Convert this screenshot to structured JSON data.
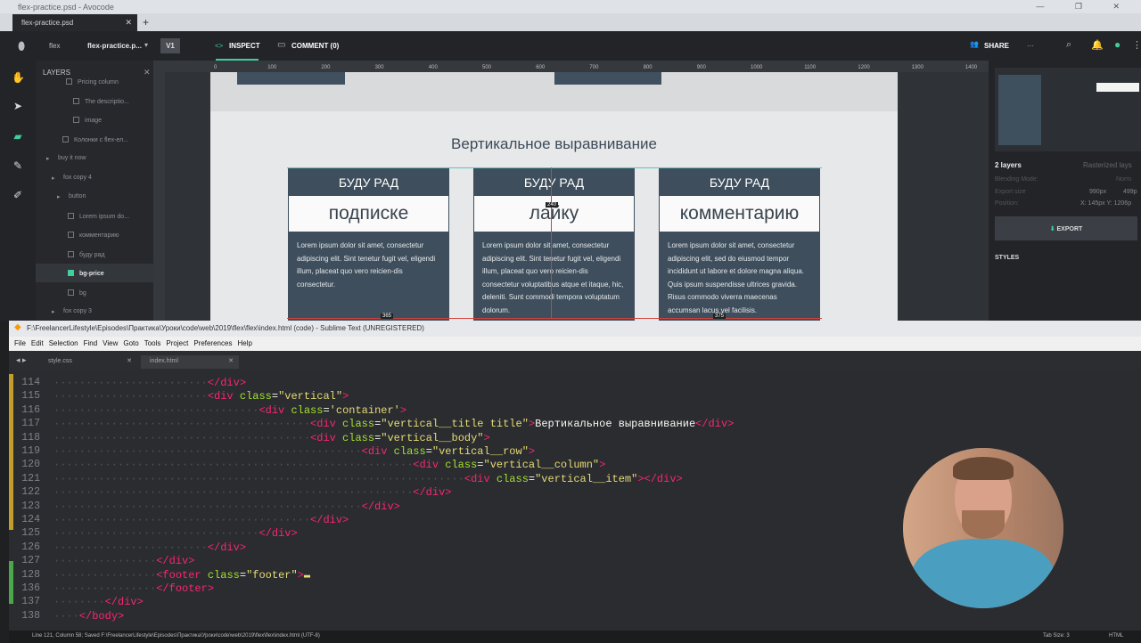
{
  "browser": {
    "title": "flex-practice.psd - Avocode",
    "tab": "flex-practice.psd",
    "new_tab": "+",
    "win_controls": "—  ❐  ✕"
  },
  "avocode": {
    "breadcrumb_project": "flex",
    "breadcrumb_file": "flex-practice.p...",
    "version": "V1",
    "inspect": "INSPECT",
    "comment": "COMMENT (0)",
    "share": "SHARE",
    "more": "···"
  },
  "layers": {
    "title": "LAYERS",
    "items": [
      {
        "label": "Pricing column",
        "kind": "text"
      },
      {
        "label": "The descriptio...",
        "kind": "text"
      },
      {
        "label": "image",
        "kind": "image"
      },
      {
        "label": "Колонки с flex-ел...",
        "kind": "text"
      },
      {
        "label": "buy it now",
        "kind": "folder"
      },
      {
        "label": "fox copy 4",
        "kind": "folder"
      },
      {
        "label": "button",
        "kind": "folder"
      },
      {
        "label": "Lorem ipsum do...",
        "kind": "text"
      },
      {
        "label": "комментарию",
        "kind": "text"
      },
      {
        "label": "буду рад",
        "kind": "text"
      },
      {
        "label": "bg-price",
        "kind": "shape",
        "selected": true
      },
      {
        "label": "bg",
        "kind": "shape"
      },
      {
        "label": "fox copy 3",
        "kind": "folder"
      }
    ]
  },
  "ruler": {
    "marks": [
      "0",
      "100",
      "200",
      "300",
      "400",
      "500",
      "600",
      "700",
      "800",
      "900",
      "1000",
      "1100",
      "1200",
      "1300",
      "1400"
    ]
  },
  "design": {
    "title": "Вертикальное выравнивание",
    "cards": [
      {
        "head": "БУДУ РАД",
        "word": "подписке",
        "text": "Lorem ipsum dolor sit amet, consectetur adipiscing elit. Sint tenetur fugit vel, eligendi illum, placeat quo vero reicien-dis consectetur."
      },
      {
        "head": "БУДУ РАД",
        "word": "лайку",
        "text": "Lorem ipsum dolor sit amet, consectetur adipiscing elit. Sint tenetur fugit vel, eligendi illum, placeat quo vero reicien-dis consectetur voluptatibus atque et itaque, hic, deleniti. Sunt commodi tempora voluptatum dolorum."
      },
      {
        "head": "БУДУ РАД",
        "word": "комментарию",
        "text": "Lorem ipsum dolor sit amet, consectetur adipiscing elit, sed do eiusmod tempor incididunt ut labore et dolore magna aliqua. Quis ipsum suspendisse ultrices gravida. Risus commodo viverra maecenas accumsan lacus vel facilisis."
      }
    ],
    "measure_1": "365",
    "measure_2": "375",
    "measure_3": "240"
  },
  "inspector": {
    "layers_count": "2 layers",
    "rasterized": "Rasterized lays",
    "blending_label": "Blending Mode:",
    "blending_value": "Norm",
    "export_size_label": "Export size",
    "w": "990px",
    "h": "499p",
    "position_label": "Position:",
    "position": "X: 145px  Y: 1206p",
    "export_btn": "EXPORT",
    "styles": "STYLES"
  },
  "sublime": {
    "title": "F:\\FreelancerLifestyle\\Episodes\\Практика\\Урoки\\code\\web\\2019\\flex\\flex\\index.html (code) - Sublime Text (UNREGISTERED)",
    "menu": [
      "File",
      "Edit",
      "Selection",
      "Find",
      "View",
      "Goto",
      "Tools",
      "Project",
      "Preferences",
      "Help"
    ],
    "tabs": [
      "style.css",
      "index.html"
    ],
    "lines": [
      {
        "n": "114",
        "indent": 12,
        "parts": [
          [
            "tg",
            "</div>"
          ]
        ]
      },
      {
        "n": "115",
        "indent": 12,
        "parts": [
          [
            "tg",
            "<div"
          ],
          [
            "at",
            " class"
          ],
          [
            "tx",
            "="
          ],
          [
            "st",
            "\"vertical\""
          ],
          [
            "tg",
            ">"
          ]
        ]
      },
      {
        "n": "116",
        "indent": 16,
        "parts": [
          [
            "tg",
            "<div"
          ],
          [
            "at",
            " class"
          ],
          [
            "tx",
            "="
          ],
          [
            "st",
            "'container'"
          ],
          [
            "tg",
            ">"
          ]
        ]
      },
      {
        "n": "117",
        "indent": 20,
        "parts": [
          [
            "tg",
            "<div"
          ],
          [
            "at",
            " class"
          ],
          [
            "tx",
            "="
          ],
          [
            "st",
            "\"vertical__title title\""
          ],
          [
            "tg",
            ">"
          ],
          [
            "tx",
            "Вертикальное выравнивание"
          ],
          [
            "tg",
            "</div>"
          ]
        ]
      },
      {
        "n": "118",
        "indent": 20,
        "parts": [
          [
            "tg",
            "<div"
          ],
          [
            "at",
            " class"
          ],
          [
            "tx",
            "="
          ],
          [
            "st",
            "\"vertical__body\""
          ],
          [
            "tg",
            ">"
          ]
        ]
      },
      {
        "n": "119",
        "indent": 24,
        "parts": [
          [
            "tg",
            "<div"
          ],
          [
            "at",
            " class"
          ],
          [
            "tx",
            "="
          ],
          [
            "st",
            "\"vertical__row\""
          ],
          [
            "tg",
            ">"
          ]
        ]
      },
      {
        "n": "120",
        "indent": 28,
        "parts": [
          [
            "tg",
            "<div"
          ],
          [
            "at",
            " class"
          ],
          [
            "tx",
            "="
          ],
          [
            "st",
            "\"vertical__column\""
          ],
          [
            "tg",
            ">"
          ]
        ]
      },
      {
        "n": "121",
        "indent": 32,
        "parts": [
          [
            "tg",
            "<div"
          ],
          [
            "at",
            " class"
          ],
          [
            "tx",
            "="
          ],
          [
            "st",
            "\"vertical__item\""
          ],
          [
            "tg",
            ">"
          ],
          [
            "tg",
            "</div>"
          ]
        ]
      },
      {
        "n": "122",
        "indent": 28,
        "parts": [
          [
            "tg",
            "</div>"
          ]
        ]
      },
      {
        "n": "123",
        "indent": 24,
        "parts": [
          [
            "tg",
            "</div>"
          ]
        ]
      },
      {
        "n": "124",
        "indent": 20,
        "parts": [
          [
            "tg",
            "</div>"
          ]
        ]
      },
      {
        "n": "125",
        "indent": 16,
        "parts": [
          [
            "tg",
            "</div>"
          ]
        ]
      },
      {
        "n": "126",
        "indent": 12,
        "parts": [
          [
            "tg",
            "</div>"
          ]
        ]
      },
      {
        "n": "127",
        "indent": 8,
        "parts": [
          [
            "tg",
            "</div>"
          ]
        ]
      },
      {
        "n": "128",
        "indent": 8,
        "parts": [
          [
            "tg",
            "<footer"
          ],
          [
            "at",
            " class"
          ],
          [
            "tx",
            "="
          ],
          [
            "st",
            "\"footer\""
          ],
          [
            "tg",
            ">"
          ],
          [
            "st",
            "▬"
          ]
        ]
      },
      {
        "n": "136",
        "indent": 8,
        "parts": [
          [
            "tg",
            "</footer>"
          ]
        ]
      },
      {
        "n": "137",
        "indent": 4,
        "parts": [
          [
            "tg",
            "</div>"
          ]
        ]
      },
      {
        "n": "138",
        "indent": 2,
        "parts": [
          [
            "tg",
            "</body>"
          ]
        ]
      }
    ],
    "status_left": "Line 121, Column 58; Saved F:\\FreelancerLifestyle\\Episodes\\Практика\\Урoки\\code\\web\\2019\\flex\\flex\\index.html (UTF-8)",
    "tab_size": "Tab Size: 3",
    "syntax": "HTML"
  },
  "colors": {
    "accent": "#3fcf9b",
    "card": "#3e4e5c",
    "tag": "#f92672",
    "attr": "#a6e22e",
    "string": "#e6db74"
  }
}
